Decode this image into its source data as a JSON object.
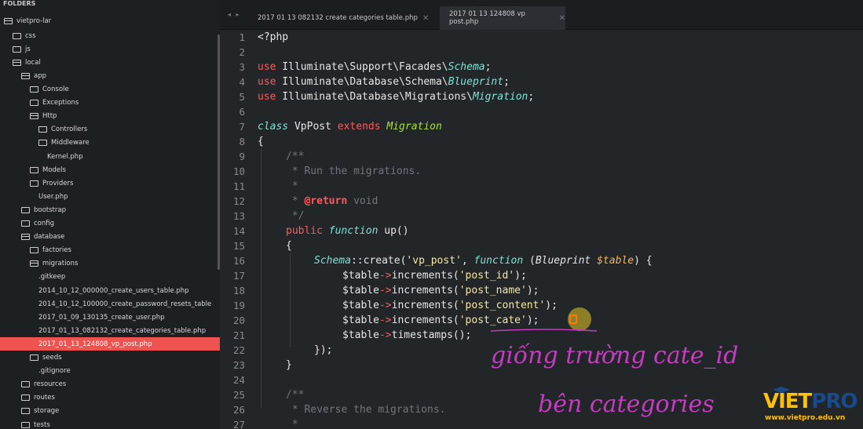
{
  "sidebar": {
    "header": "FOLDERS",
    "items": [
      {
        "label": "vietpro-lar",
        "indent": 0,
        "open": true
      },
      {
        "label": "css",
        "indent": 1,
        "open": false
      },
      {
        "label": "js",
        "indent": 1,
        "open": false
      },
      {
        "label": "local",
        "indent": 1,
        "open": true
      },
      {
        "label": "app",
        "indent": 2,
        "open": true
      },
      {
        "label": "Console",
        "indent": 3,
        "open": false
      },
      {
        "label": "Exceptions",
        "indent": 3,
        "open": false
      },
      {
        "label": "Http",
        "indent": 3,
        "open": true
      },
      {
        "label": "Controllers",
        "indent": 4,
        "open": false
      },
      {
        "label": "Middleware",
        "indent": 4,
        "open": false
      },
      {
        "label": "Kernel.php",
        "indent": 5,
        "file": true
      },
      {
        "label": "Models",
        "indent": 3,
        "open": false
      },
      {
        "label": "Providers",
        "indent": 3,
        "open": false
      },
      {
        "label": "User.php",
        "indent": 4,
        "file": true
      },
      {
        "label": "bootstrap",
        "indent": 2,
        "open": false
      },
      {
        "label": "config",
        "indent": 2,
        "open": false
      },
      {
        "label": "database",
        "indent": 2,
        "open": true
      },
      {
        "label": "factories",
        "indent": 3,
        "open": false
      },
      {
        "label": "migrations",
        "indent": 3,
        "open": true
      },
      {
        "label": ".gitkeep",
        "indent": 4,
        "file": true
      },
      {
        "label": "2014_10_12_000000_create_users_table.php",
        "indent": 4,
        "file": true
      },
      {
        "label": "2014_10_12_100000_create_password_resets_table",
        "indent": 4,
        "file": true
      },
      {
        "label": "2017_01_09_130135_create_user.php",
        "indent": 4,
        "file": true
      },
      {
        "label": "2017_01_13_082132_create_categories_table.php",
        "indent": 4,
        "file": true
      },
      {
        "label": "2017_01_13_124808_vp_post.php",
        "indent": 4,
        "file": true,
        "selected": true
      },
      {
        "label": "seeds",
        "indent": 3,
        "open": false
      },
      {
        "label": ".gitignore",
        "indent": 4,
        "file": true
      },
      {
        "label": "resources",
        "indent": 2,
        "open": false
      },
      {
        "label": "routes",
        "indent": 2,
        "open": false
      },
      {
        "label": "storage",
        "indent": 2,
        "open": false
      },
      {
        "label": "tests",
        "indent": 2,
        "open": false
      }
    ]
  },
  "tabs": {
    "nav": "◂ ▸",
    "items": [
      {
        "label": "2017 01 13 082132 create categories table.php",
        "active": false
      },
      {
        "label": "2017 01 13 124808 vp post.php",
        "active": true
      }
    ],
    "close_glyph": "✕"
  },
  "editor": {
    "line_numbers": [
      "1",
      "2",
      "3",
      "4",
      "5",
      "6",
      "7",
      "8",
      "9",
      "10",
      "11",
      "12",
      "13",
      "14",
      "15",
      "16",
      "17",
      "18",
      "19",
      "20",
      "21",
      "22",
      "23",
      "24",
      "25",
      "26",
      "27"
    ],
    "lines": {
      "l1": "<?php",
      "l3_kw": "use",
      "l3_path": " Illuminate\\Support\\Facades\\",
      "l3_cls": "Schema",
      "l3_end": ";",
      "l4_kw": "use",
      "l4_path": " Illuminate\\Database\\Schema\\",
      "l4_cls": "Blueprint",
      "l4_end": ";",
      "l5_kw": "use",
      "l5_path": " Illuminate\\Database\\Migrations\\",
      "l5_cls": "Migration",
      "l5_end": ";",
      "l7_class": "class",
      "l7_name": " VpPost ",
      "l7_extends": "extends",
      "l7_parent": " Migration",
      "l8": "{",
      "l9": "/**",
      "l10": " * Run the migrations.",
      "l11": " *",
      "l12_pre": " * ",
      "l12_ret": "@return",
      "l12_post": " void",
      "l13": " */",
      "l14_pub": "public",
      "l14_fn": " function",
      "l14_name": " up",
      "l14_end": "()",
      "l15": "{",
      "l16_schema": "Schema",
      "l16_op": "::create(",
      "l16_str": "'vp_post'",
      "l16_comma": ", ",
      "l16_fn": "function",
      "l16_paren": " (",
      "l16_bp": "Blueprint",
      "l16_sp": " ",
      "l16_var": "$table",
      "l16_end": ") {",
      "l17_var": "$table",
      "l17_op": "->",
      "l17_call": "increments(",
      "l17_str": "'post_id'",
      "l17_end": ");",
      "l18_var": "$table",
      "l18_op": "->",
      "l18_call": "increments(",
      "l18_str": "'post_name'",
      "l18_end": ");",
      "l19_var": "$table",
      "l19_op": "->",
      "l19_call": "increments(",
      "l19_str": "'post_content'",
      "l19_end": ");",
      "l20_var": "$table",
      "l20_op": "->",
      "l20_call": "increments(",
      "l20_str": "'post_cate'",
      "l20_end": ");",
      "l21_var": "$table",
      "l21_op": "->",
      "l21_call": "timestamps();",
      "l22": "});",
      "l23": "}",
      "l25": "/**",
      "l26": " * Reverse the migrations.",
      "l27": " *"
    }
  },
  "annotation": {
    "line1": "giống trường cate_id",
    "line2": "bên categories",
    "color": "#c53cc0"
  },
  "logo": {
    "brand_v": "VIET",
    "brand_p": "PRO",
    "url": "www.vietpro.edu.vn"
  }
}
